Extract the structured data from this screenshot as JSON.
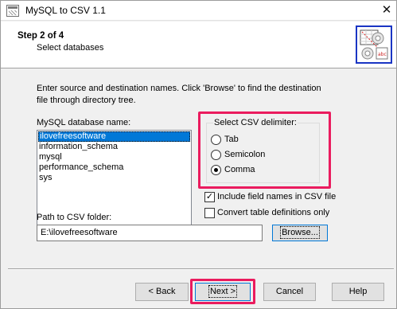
{
  "window": {
    "title": "MySQL to CSV 1.1",
    "close_glyph": "✕"
  },
  "header": {
    "step_title": "Step 2 of 4",
    "step_subtitle": "Select databases",
    "logo_icon": "wizard-logo-icon"
  },
  "instructions": {
    "line1": "Enter source and destination names. Click 'Browse' to find the destination",
    "line2": "file through directory tree."
  },
  "database_list": {
    "label": "MySQL database name:",
    "items": [
      "ilovefreesoftware",
      "information_schema",
      "mysql",
      "performance_schema",
      "sys"
    ],
    "selected_index": 0
  },
  "delimiter": {
    "legend": "Select CSV delimiter:",
    "options": [
      "Tab",
      "Semicolon",
      "Comma"
    ],
    "selected": "Comma"
  },
  "options": {
    "include_field_names": {
      "label": "Include field names in CSV file",
      "checked": true
    },
    "convert_table_definitions": {
      "label": "Convert table definitions only",
      "checked": false
    }
  },
  "path": {
    "label": "Path to CSV folder:",
    "value": "E:\\ilovefreesoftware"
  },
  "buttons": {
    "browse": "Browse...",
    "back": "< Back",
    "next": "Next >",
    "cancel": "Cancel",
    "help": "Help"
  },
  "colors": {
    "highlight": "#ea1b5e",
    "selection": "#0078d7",
    "logo_border": "#1a35c4"
  }
}
